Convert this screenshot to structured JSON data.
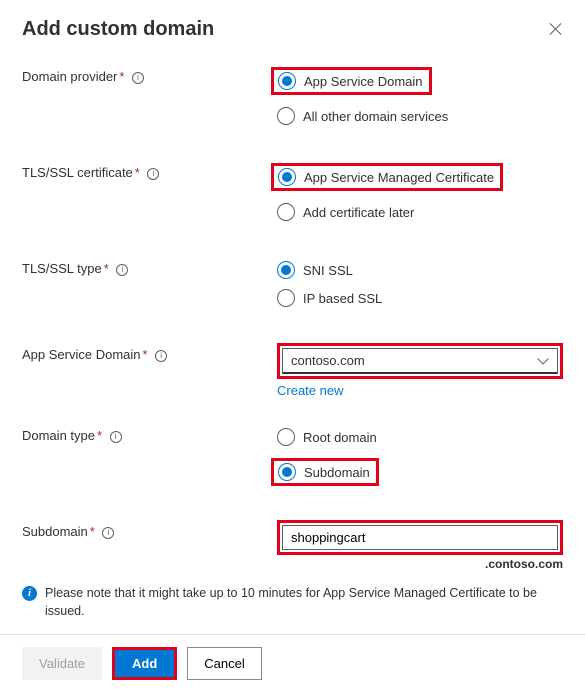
{
  "header": {
    "title": "Add custom domain"
  },
  "fields": {
    "domain_provider": {
      "label": "Domain provider",
      "options": [
        "App Service Domain",
        "All other domain services"
      ],
      "selected": "App Service Domain"
    },
    "tls_cert": {
      "label": "TLS/SSL certificate",
      "options": [
        "App Service Managed Certificate",
        "Add certificate later"
      ],
      "selected": "App Service Managed Certificate"
    },
    "tls_type": {
      "label": "TLS/SSL type",
      "options": [
        "SNI SSL",
        "IP based SSL"
      ],
      "selected": "SNI SSL"
    },
    "app_service_domain": {
      "label": "App Service Domain",
      "value": "contoso.com",
      "create_new": "Create new"
    },
    "domain_type": {
      "label": "Domain type",
      "options": [
        "Root domain",
        "Subdomain"
      ],
      "selected": "Subdomain"
    },
    "subdomain": {
      "label": "Subdomain",
      "value": "shoppingcart",
      "suffix": ".contoso.com"
    }
  },
  "note": "Please note that it might take up to 10 minutes for App Service Managed Certificate to be issued.",
  "footer": {
    "validate": "Validate",
    "add": "Add",
    "cancel": "Cancel"
  }
}
